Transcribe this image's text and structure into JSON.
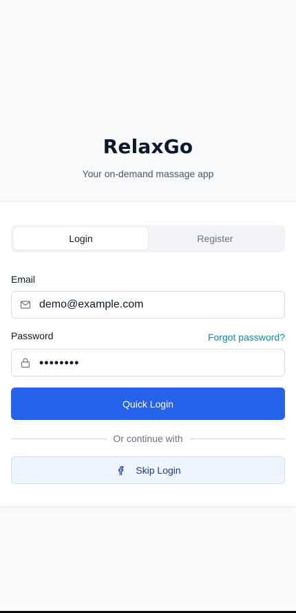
{
  "app": {
    "title": "RelaxGo",
    "tagline": "Your on-demand massage app"
  },
  "tabs": [
    {
      "label": "Login",
      "active": true
    },
    {
      "label": "Register",
      "active": false
    }
  ],
  "form": {
    "email_label": "Email",
    "email_value": "demo@example.com",
    "email_icon": "mail-icon",
    "password_label": "Password",
    "password_value": "••••••••",
    "password_icon": "lock-icon",
    "forgot_label": "Forgot password?"
  },
  "actions": {
    "primary_label": "Quick Login",
    "divider_label": "Or continue with",
    "secondary_label": "Skip Login",
    "secondary_icon": "facebook-icon"
  },
  "colors": {
    "primary": "#2563eb",
    "link": "#0e8ba5",
    "secondary_bg": "#eff5ff"
  }
}
